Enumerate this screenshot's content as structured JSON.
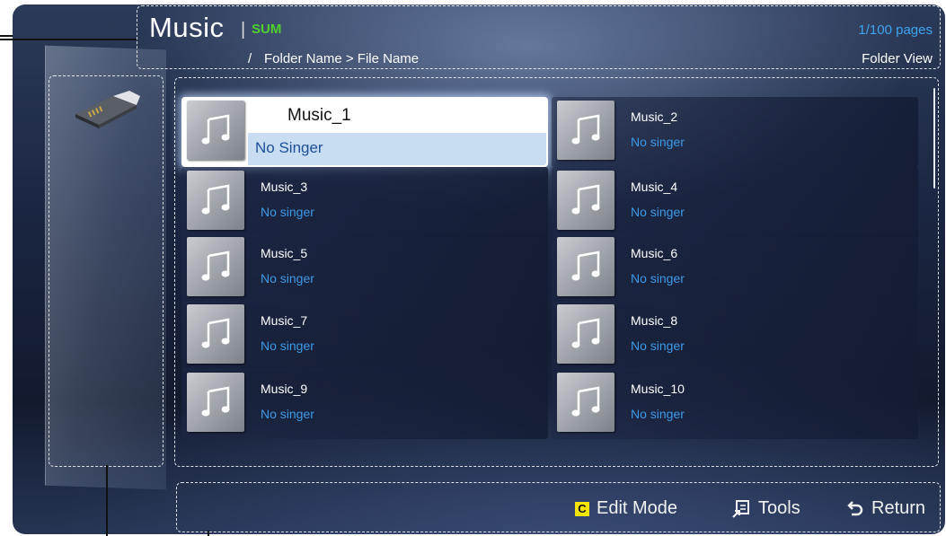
{
  "header": {
    "title": "Music",
    "separator": "|",
    "device": "SUM",
    "pages": "1/100 pages",
    "path_prefix": "/",
    "path": "Folder Name > File Name",
    "view_mode": "Folder View"
  },
  "device_panel": {
    "icon": "usb-drive-icon"
  },
  "items": [
    {
      "name": "Music_1",
      "artist": "No Singer",
      "selected": true
    },
    {
      "name": "Music_2",
      "artist": "No singer"
    },
    {
      "name": "Music_3",
      "artist": "No singer"
    },
    {
      "name": "Music_4",
      "artist": "No singer"
    },
    {
      "name": "Music_5",
      "artist": "No singer"
    },
    {
      "name": "Music_6",
      "artist": "No singer"
    },
    {
      "name": "Music_7",
      "artist": "No singer"
    },
    {
      "name": "Music_8",
      "artist": "No singer"
    },
    {
      "name": "Music_9",
      "artist": "No singer"
    },
    {
      "name": "Music_10",
      "artist": "No singer"
    }
  ],
  "buttons": {
    "edit_key": "C",
    "edit_label": "Edit Mode",
    "tools_label": "Tools",
    "return_label": "Return"
  },
  "colors": {
    "device_accent": "#4fd12e",
    "pages_text": "#3fa4ee",
    "artist_text": "#3f9ae6",
    "c_key": "#f4e500"
  }
}
